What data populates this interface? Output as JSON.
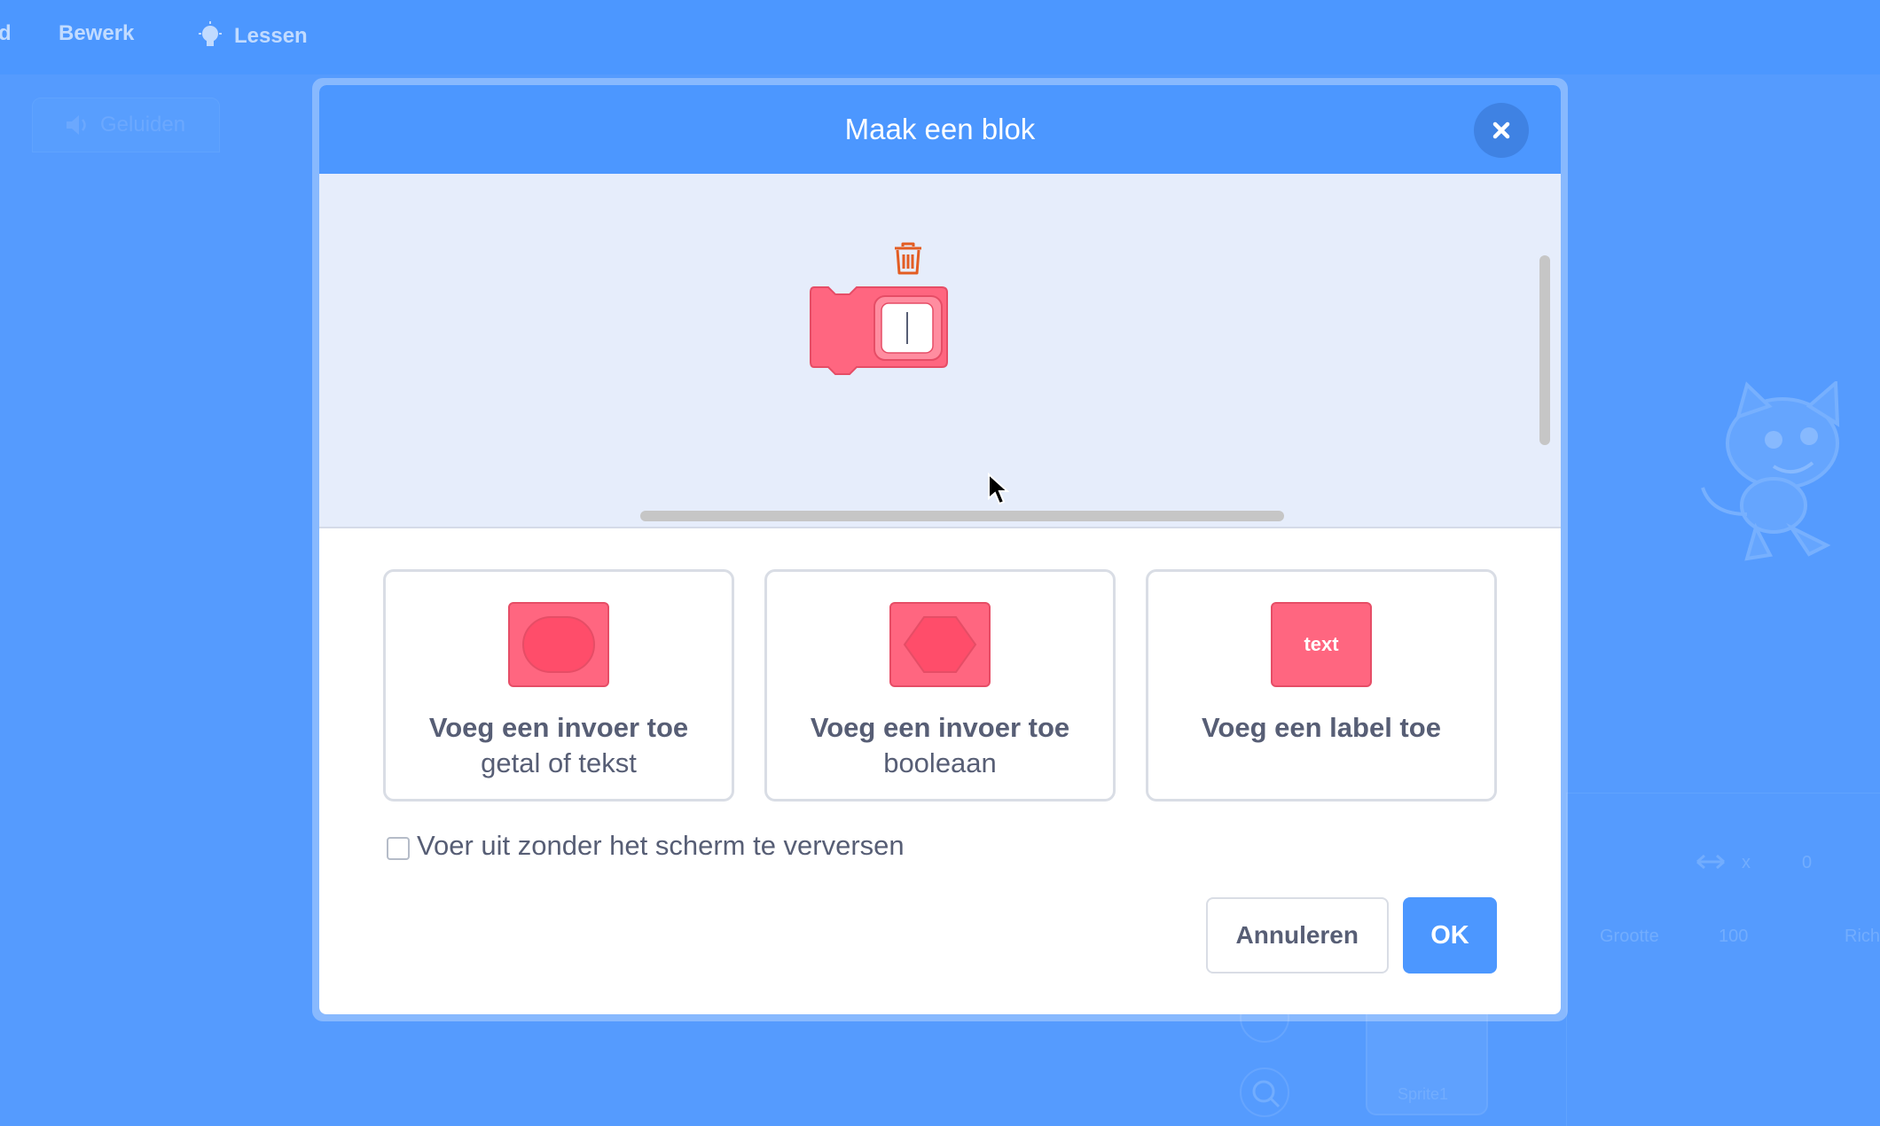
{
  "menubar": {
    "file_partial": "d",
    "edit": "Bewerk",
    "tutorials": "Lessen"
  },
  "background": {
    "sounds_tab": "Geluiden",
    "x_label": "x",
    "x_value": "0",
    "size_label": "Grootte",
    "size_value": "100",
    "direction_partial": "Rich",
    "sprite_name": "Sprite1"
  },
  "dialog": {
    "title": "Maak een blok",
    "options": [
      {
        "icon": "round-input-icon",
        "title": "Voeg een invoer toe",
        "subtitle": "getal of tekst"
      },
      {
        "icon": "hexagon-input-icon",
        "title": "Voeg een invoer toe",
        "subtitle": "booleaan"
      },
      {
        "icon": "label-text-icon",
        "icon_text": "text",
        "title": "Voeg een label toe",
        "subtitle": ""
      }
    ],
    "checkbox_label": "Voer uit zonder het scherm te verversen",
    "checkbox_checked": false,
    "cancel_label": "Annuleren",
    "ok_label": "OK"
  },
  "colors": {
    "accent": "#4c97ff",
    "block": "#ff6680",
    "block_border": "#e64d66",
    "trash": "#e35d23",
    "text": "#575e75"
  }
}
